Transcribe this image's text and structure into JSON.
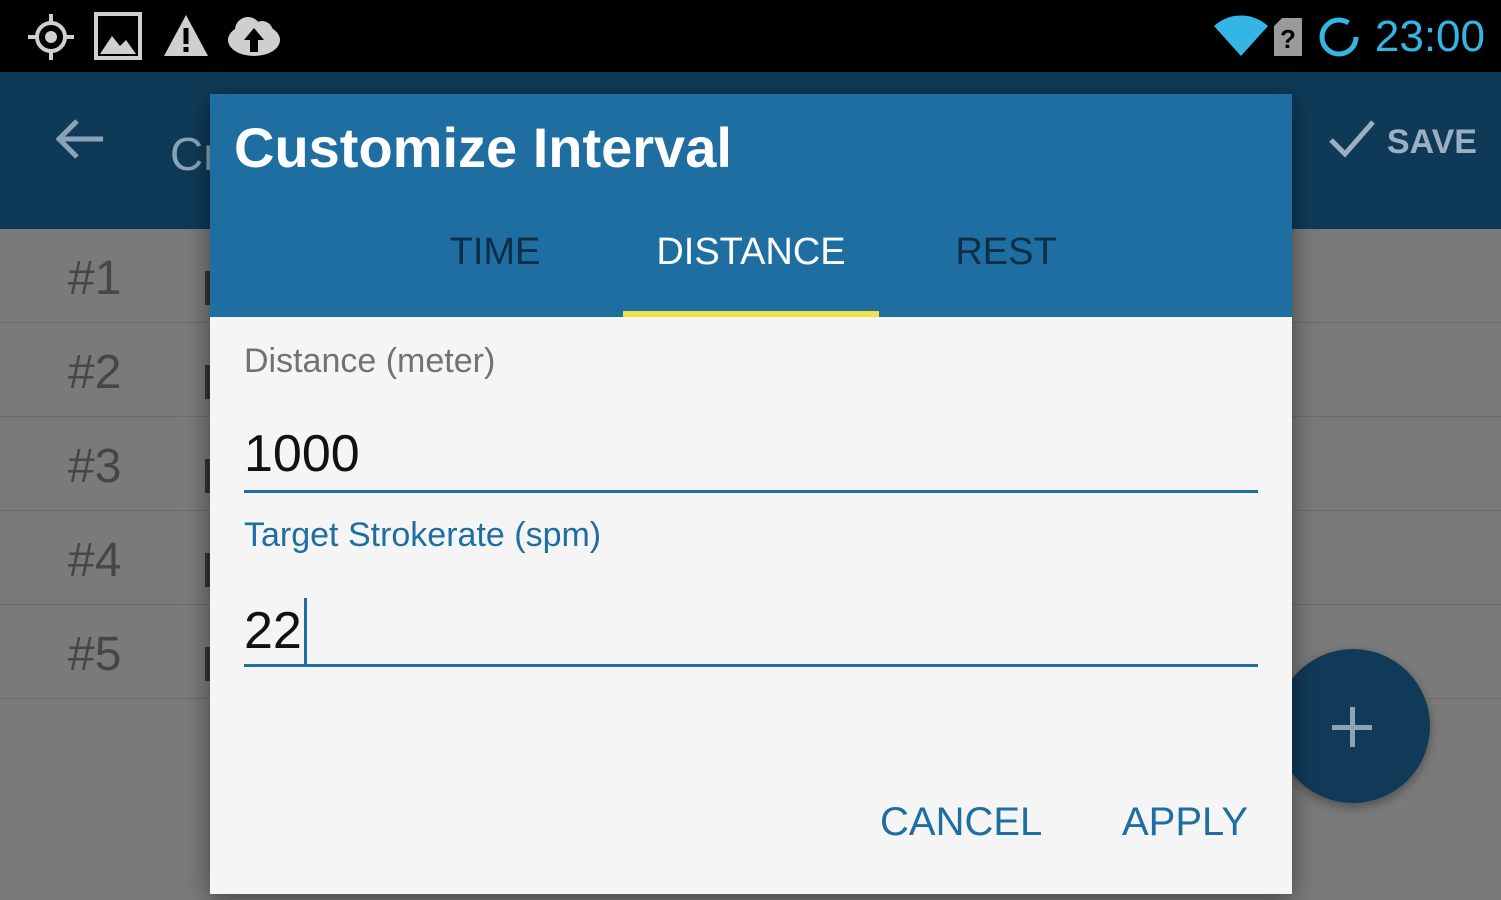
{
  "status_bar": {
    "time": "23:00",
    "left_icons": [
      "location-icon",
      "image-icon",
      "warning-icon",
      "cloud-upload-icon"
    ],
    "right_icons": [
      "wifi-icon",
      "sim-unknown-icon",
      "sync-circle-icon"
    ],
    "clock_color": "#33b5e5"
  },
  "app_bar": {
    "title_partial": "Cr",
    "save_label": "SAVE"
  },
  "interval_list": [
    {
      "label": "#1"
    },
    {
      "label": "#2"
    },
    {
      "label": "#3"
    },
    {
      "label": "#4"
    },
    {
      "label": "#5"
    }
  ],
  "fab": {
    "icon": "plus-icon"
  },
  "dialog": {
    "title": "Customize Interval",
    "tabs": [
      {
        "label": "TIME",
        "selected": false
      },
      {
        "label": "DISTANCE",
        "selected": true
      },
      {
        "label": "REST",
        "selected": false
      }
    ],
    "fields": {
      "distance": {
        "label": "Distance (meter)",
        "value": "1000"
      },
      "strokerate": {
        "label": "Target Strokerate (spm)",
        "value": "22"
      }
    },
    "buttons": {
      "cancel": "CANCEL",
      "apply": "APPLY"
    },
    "colors": {
      "header": "#1f6ea2",
      "tab_indicator": "#f0e04a",
      "accent": "#1f6ea2"
    }
  }
}
